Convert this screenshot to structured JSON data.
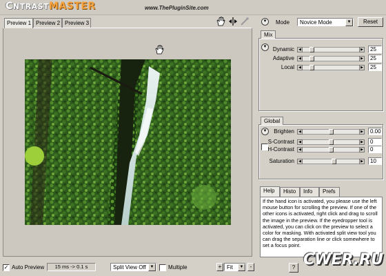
{
  "header": {
    "logo_first": "C",
    "logo_mid": "NTRAST",
    "logo_second": "MASTER",
    "site": "www.ThePluginSite.com"
  },
  "preview_tabs": [
    "Preview 1",
    "Preview 2",
    "Preview 3"
  ],
  "toolbar": {
    "icons": [
      "hand-icon",
      "split-view-icon",
      "eyedropper-icon"
    ]
  },
  "bottom": {
    "auto_preview_label": "Auto Preview",
    "auto_preview_checked": true,
    "timing": "15 ms -> 0.1 s",
    "split_view": "Split View Off",
    "multiple_label": "Multiple",
    "multiple_checked": false,
    "zoom_plus": "+",
    "zoom": "Fit",
    "zoom_minus": "-",
    "help_button": "?"
  },
  "mode": {
    "label": "Mode",
    "value": "Novice Mode",
    "reset": "Reset"
  },
  "mix": {
    "title": "Mix",
    "sliders": [
      {
        "label": "Dynamic",
        "value": "25",
        "pos": 0.12
      },
      {
        "label": "Adaptive",
        "value": "25",
        "pos": 0.12
      },
      {
        "label": "Local",
        "value": "25",
        "pos": 0.12
      }
    ]
  },
  "global": {
    "title": "Global",
    "brighten": {
      "label": "Brighten",
      "value": "0.00",
      "pos": 0.5
    },
    "s_contrast": {
      "label": "S-Contrast",
      "value": "0",
      "pos": 0.5
    },
    "h_contrast": {
      "label": "H-Contrast",
      "value": "0",
      "pos": 0.5
    },
    "saturation": {
      "label": "Saturation",
      "value": "10",
      "pos": 0.55
    }
  },
  "help_tabs": [
    "Help",
    "Histo",
    "Info",
    "Prefs"
  ],
  "help_text": "If the hand icon is activated, you please use the left mouse button for scrolling the preview. If one of the other icons is activated, right click and drag to scroll the image in the preview. If the eyedropper tool is activated, you can click on the preview to select a color for masking. With activated split view tool you can drag the separation line or click somewhere to set a focus point.",
  "watermark": "CWER.RU",
  "colors": {
    "logo_accent": "#f5a23c",
    "panel": "#d4d0c8"
  }
}
